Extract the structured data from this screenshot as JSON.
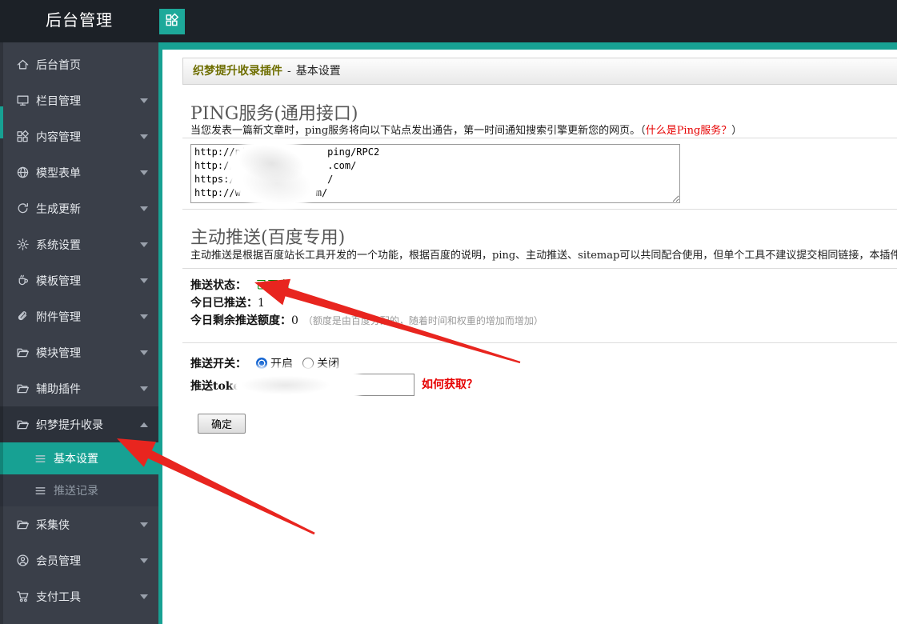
{
  "topbar": {
    "title": "后台管理"
  },
  "sidebar": {
    "menu": [
      {
        "key": "backend-home",
        "label": "后台首页",
        "icon": "home-icon"
      },
      {
        "key": "column-manage",
        "label": "栏目管理",
        "icon": "monitor-icon",
        "chevron": "down"
      },
      {
        "key": "content-manage",
        "label": "内容管理",
        "icon": "grid-icon",
        "chevron": "down"
      },
      {
        "key": "model-form",
        "label": "模型表单",
        "icon": "globe-icon",
        "chevron": "down"
      },
      {
        "key": "generate-update",
        "label": "生成更新",
        "icon": "refresh-icon",
        "chevron": "down"
      },
      {
        "key": "system-settings",
        "label": "系统设置",
        "icon": "gear-icon",
        "chevron": "down"
      },
      {
        "key": "template-manage",
        "label": "模板管理",
        "icon": "cup-icon",
        "chevron": "down"
      },
      {
        "key": "attachment-manage",
        "label": "附件管理",
        "icon": "paperclip-icon",
        "chevron": "down"
      },
      {
        "key": "module-manage",
        "label": "模块管理",
        "icon": "folder-icon",
        "chevron": "down"
      },
      {
        "key": "auxiliary-plugins",
        "label": "辅助插件",
        "icon": "folder-icon",
        "chevron": "down"
      },
      {
        "key": "zhimeng-boost-index",
        "label": "织梦提升收录",
        "icon": "folder-icon",
        "chevron": "up",
        "expanded": true
      },
      {
        "key": "basic-settings",
        "label": "基本设置",
        "icon": "list-icon",
        "submenu": true,
        "active": true
      },
      {
        "key": "push-records",
        "label": "推送记录",
        "icon": "list-icon",
        "submenu": true
      },
      {
        "key": "caijixia",
        "label": "采集侠",
        "icon": "folder-icon",
        "chevron": "down"
      },
      {
        "key": "member-manage",
        "label": "会员管理",
        "icon": "user-icon",
        "chevron": "down"
      },
      {
        "key": "payment-tools",
        "label": "支付工具",
        "icon": "cart-icon",
        "chevron": "down"
      }
    ]
  },
  "breadcrumb": {
    "plugin_name": "织梦提升收录插件",
    "separator": "-",
    "page_name": "基本设置"
  },
  "ping": {
    "heading": "PING服务(通用接口)",
    "desc_prefix": "当您发表一篇新文章时，ping服务将向以下站点发出通告，第一时间通知搜索引擎更新您的网页。（",
    "desc_link": "什么是Ping服务？",
    "desc_suffix": "）",
    "urls": "http://ping.           ping/RPC2\nhttp://rpc.            .com/\nhttps://ww             /\nhttp://w             m/"
  },
  "push": {
    "heading": "主动推送(百度专用)",
    "desc": "主动推送是根据百度站长工具开发的一个功能，根据百度的说明，ping、主动推送、sitemap可以共同配合使用，但单个工具不建议提交相同链接，本插件完全根据百度",
    "status_label": "推送状态：",
    "status_value": "已开启",
    "pushed_label": "今日已推送：",
    "pushed_value": "1",
    "quota_label": "今日剩余推送额度：",
    "quota_value": "0",
    "quota_note": "（额度是由百度分配的，随着时间和权重的增加而增加）",
    "switch_label": "推送开关：",
    "switch_on": "开启",
    "switch_off": "关闭",
    "token_label": "推送token:",
    "token_help": "如何获取？",
    "submit_label": "确定"
  },
  "colors": {
    "accent_teal": "#17a193",
    "status_green": "#008800",
    "alert_red": "#e60000",
    "plugin_title_olive": "#6e6e00",
    "topbar_bg": "#1c2127",
    "sidebar_bg": "#3a3f49"
  }
}
